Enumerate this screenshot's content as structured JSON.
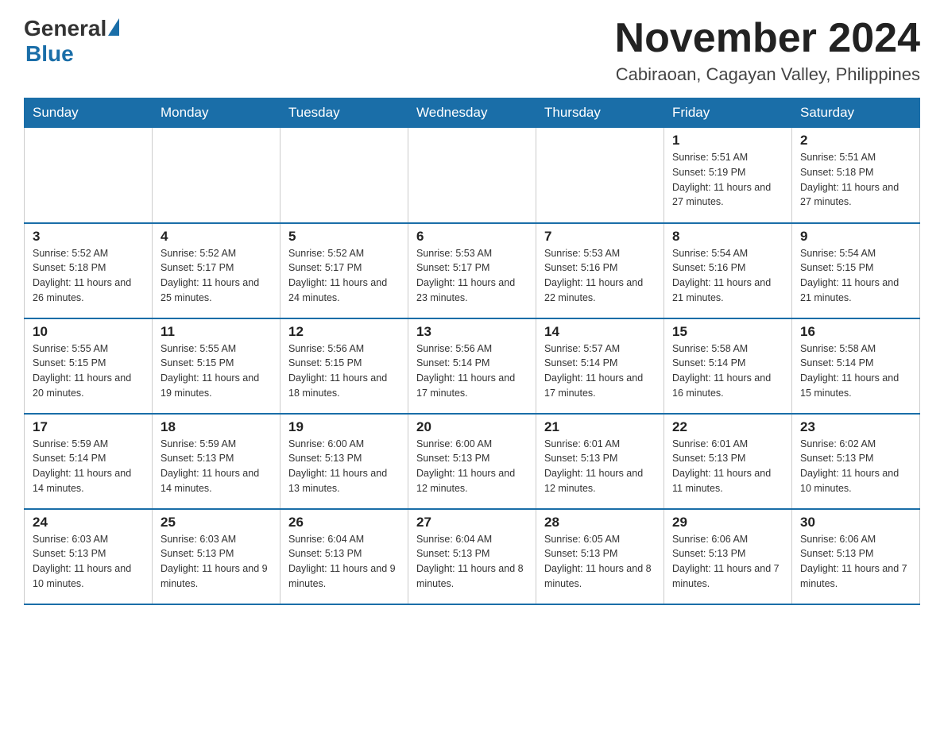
{
  "logo": {
    "general": "General",
    "blue": "Blue"
  },
  "title": "November 2024",
  "location": "Cabiraoan, Cagayan Valley, Philippines",
  "days_of_week": [
    "Sunday",
    "Monday",
    "Tuesday",
    "Wednesday",
    "Thursday",
    "Friday",
    "Saturday"
  ],
  "weeks": [
    [
      {
        "day": "",
        "info": ""
      },
      {
        "day": "",
        "info": ""
      },
      {
        "day": "",
        "info": ""
      },
      {
        "day": "",
        "info": ""
      },
      {
        "day": "",
        "info": ""
      },
      {
        "day": "1",
        "info": "Sunrise: 5:51 AM\nSunset: 5:19 PM\nDaylight: 11 hours and 27 minutes."
      },
      {
        "day": "2",
        "info": "Sunrise: 5:51 AM\nSunset: 5:18 PM\nDaylight: 11 hours and 27 minutes."
      }
    ],
    [
      {
        "day": "3",
        "info": "Sunrise: 5:52 AM\nSunset: 5:18 PM\nDaylight: 11 hours and 26 minutes."
      },
      {
        "day": "4",
        "info": "Sunrise: 5:52 AM\nSunset: 5:17 PM\nDaylight: 11 hours and 25 minutes."
      },
      {
        "day": "5",
        "info": "Sunrise: 5:52 AM\nSunset: 5:17 PM\nDaylight: 11 hours and 24 minutes."
      },
      {
        "day": "6",
        "info": "Sunrise: 5:53 AM\nSunset: 5:17 PM\nDaylight: 11 hours and 23 minutes."
      },
      {
        "day": "7",
        "info": "Sunrise: 5:53 AM\nSunset: 5:16 PM\nDaylight: 11 hours and 22 minutes."
      },
      {
        "day": "8",
        "info": "Sunrise: 5:54 AM\nSunset: 5:16 PM\nDaylight: 11 hours and 21 minutes."
      },
      {
        "day": "9",
        "info": "Sunrise: 5:54 AM\nSunset: 5:15 PM\nDaylight: 11 hours and 21 minutes."
      }
    ],
    [
      {
        "day": "10",
        "info": "Sunrise: 5:55 AM\nSunset: 5:15 PM\nDaylight: 11 hours and 20 minutes."
      },
      {
        "day": "11",
        "info": "Sunrise: 5:55 AM\nSunset: 5:15 PM\nDaylight: 11 hours and 19 minutes."
      },
      {
        "day": "12",
        "info": "Sunrise: 5:56 AM\nSunset: 5:15 PM\nDaylight: 11 hours and 18 minutes."
      },
      {
        "day": "13",
        "info": "Sunrise: 5:56 AM\nSunset: 5:14 PM\nDaylight: 11 hours and 17 minutes."
      },
      {
        "day": "14",
        "info": "Sunrise: 5:57 AM\nSunset: 5:14 PM\nDaylight: 11 hours and 17 minutes."
      },
      {
        "day": "15",
        "info": "Sunrise: 5:58 AM\nSunset: 5:14 PM\nDaylight: 11 hours and 16 minutes."
      },
      {
        "day": "16",
        "info": "Sunrise: 5:58 AM\nSunset: 5:14 PM\nDaylight: 11 hours and 15 minutes."
      }
    ],
    [
      {
        "day": "17",
        "info": "Sunrise: 5:59 AM\nSunset: 5:14 PM\nDaylight: 11 hours and 14 minutes."
      },
      {
        "day": "18",
        "info": "Sunrise: 5:59 AM\nSunset: 5:13 PM\nDaylight: 11 hours and 14 minutes."
      },
      {
        "day": "19",
        "info": "Sunrise: 6:00 AM\nSunset: 5:13 PM\nDaylight: 11 hours and 13 minutes."
      },
      {
        "day": "20",
        "info": "Sunrise: 6:00 AM\nSunset: 5:13 PM\nDaylight: 11 hours and 12 minutes."
      },
      {
        "day": "21",
        "info": "Sunrise: 6:01 AM\nSunset: 5:13 PM\nDaylight: 11 hours and 12 minutes."
      },
      {
        "day": "22",
        "info": "Sunrise: 6:01 AM\nSunset: 5:13 PM\nDaylight: 11 hours and 11 minutes."
      },
      {
        "day": "23",
        "info": "Sunrise: 6:02 AM\nSunset: 5:13 PM\nDaylight: 11 hours and 10 minutes."
      }
    ],
    [
      {
        "day": "24",
        "info": "Sunrise: 6:03 AM\nSunset: 5:13 PM\nDaylight: 11 hours and 10 minutes."
      },
      {
        "day": "25",
        "info": "Sunrise: 6:03 AM\nSunset: 5:13 PM\nDaylight: 11 hours and 9 minutes."
      },
      {
        "day": "26",
        "info": "Sunrise: 6:04 AM\nSunset: 5:13 PM\nDaylight: 11 hours and 9 minutes."
      },
      {
        "day": "27",
        "info": "Sunrise: 6:04 AM\nSunset: 5:13 PM\nDaylight: 11 hours and 8 minutes."
      },
      {
        "day": "28",
        "info": "Sunrise: 6:05 AM\nSunset: 5:13 PM\nDaylight: 11 hours and 8 minutes."
      },
      {
        "day": "29",
        "info": "Sunrise: 6:06 AM\nSunset: 5:13 PM\nDaylight: 11 hours and 7 minutes."
      },
      {
        "day": "30",
        "info": "Sunrise: 6:06 AM\nSunset: 5:13 PM\nDaylight: 11 hours and 7 minutes."
      }
    ]
  ]
}
